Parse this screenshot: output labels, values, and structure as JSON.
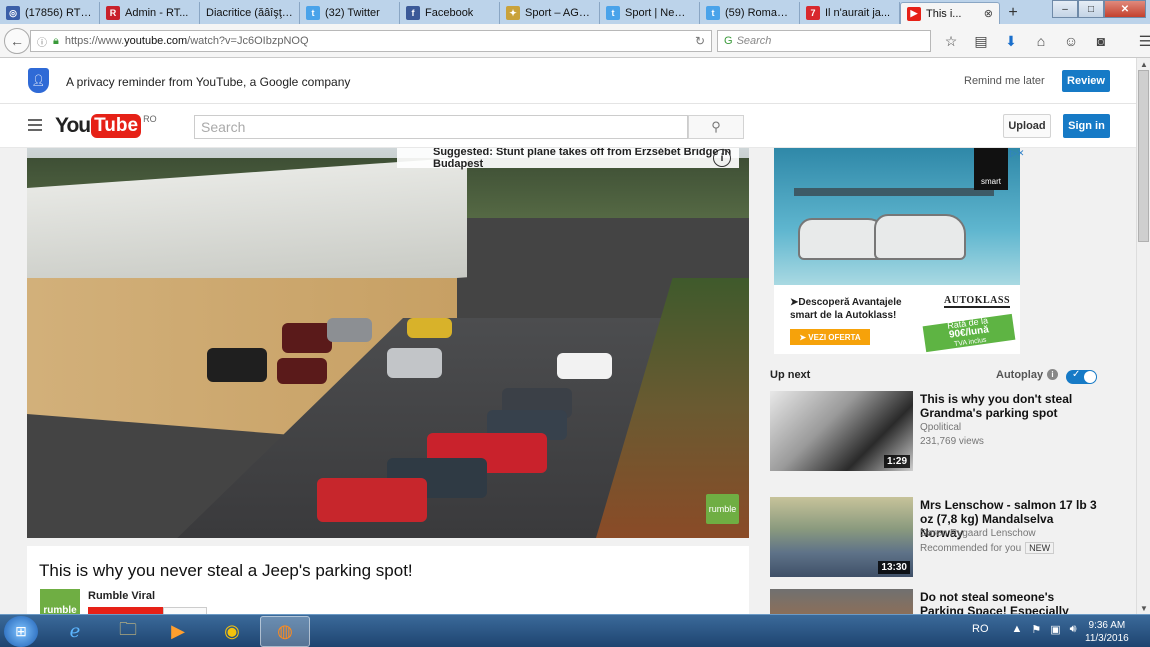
{
  "browser": {
    "tabs": [
      {
        "title": "(17856) RTV ...",
        "icon": "globe-icon",
        "color": "#3b5fa8"
      },
      {
        "title": "Admin - RT...",
        "icon": "r-logo-icon",
        "color": "#c8202b"
      },
      {
        "title": "Diacritice (ăâîşţ) ...",
        "icon": "none",
        "color": ""
      },
      {
        "title": "(32) Twitter",
        "icon": "twitter-icon",
        "color": "#4aa3ea"
      },
      {
        "title": "Facebook",
        "icon": "facebook-icon",
        "color": "#3b5998"
      },
      {
        "title": "Sport – AGE...",
        "icon": "puzzle-icon",
        "color": "#c9a23b"
      },
      {
        "title": "Sport | News...",
        "icon": "twitter-icon",
        "color": "#4aa3ea"
      },
      {
        "title": "(59) Romani...",
        "icon": "twitter-icon",
        "color": "#4aa3ea"
      },
      {
        "title": "Il n'aurait ja...",
        "icon": "seven-icon",
        "color": "#d8282d"
      },
      {
        "title": "This i...",
        "icon": "youtube-icon",
        "color": "#e62117"
      }
    ],
    "new_tab": "+",
    "url_prefix": "https://www.",
    "url_domain": "youtube.com",
    "url_path": "/watch?v=Jc6OIbzpNOQ",
    "search_placeholder": "Search"
  },
  "privacy": {
    "message": "A privacy reminder from YouTube, a Google company",
    "remind_later": "Remind me later",
    "review": "Review"
  },
  "header": {
    "logo_you": "You",
    "logo_tube": "Tube",
    "region": "RO",
    "search_placeholder": "Search",
    "upload": "Upload",
    "sign_in": "Sign in"
  },
  "player": {
    "suggested": "Suggested: Stunt plane takes off from Erzsébet Bridge in Budapest",
    "info": "i",
    "watermark": "rumble"
  },
  "video": {
    "title": "This is why you never steal a Jeep's parking spot!",
    "channel": "Rumble Viral",
    "avatar_text": "rumble"
  },
  "ad": {
    "badge": "smart",
    "headline": "➤Descoperă Avantajele smart de la Autoklass!",
    "cta": "➤ VEZI OFERTA",
    "brand": "AUTOKLASS",
    "price_top": "Rată de la",
    "price_main": "90€/lună",
    "price_note": "TVA inclus"
  },
  "sidebar": {
    "up_next": "Up next",
    "autoplay": "Autoplay",
    "autoplay_on": 1,
    "videos": [
      {
        "title": "This is why you don't steal Grandma's parking spot",
        "channel": "Qpolitical",
        "meta": "231,769 views",
        "duration": "1:29",
        "new": ""
      },
      {
        "title": "Mrs Lenschow - salmon 17 lb 3 oz (7,8 kg) Mandalselva Norway",
        "channel": "Søren Rygaard Lenschow",
        "meta": "Recommended for you",
        "duration": "13:30",
        "new": "NEW"
      },
      {
        "title": "Do not steal someone's Parking Space! Especially woman's.",
        "channel": "",
        "meta": "",
        "duration": "",
        "new": ""
      }
    ]
  },
  "taskbar": {
    "language": "RO",
    "time": "9:36 AM",
    "date": "11/3/2016"
  }
}
